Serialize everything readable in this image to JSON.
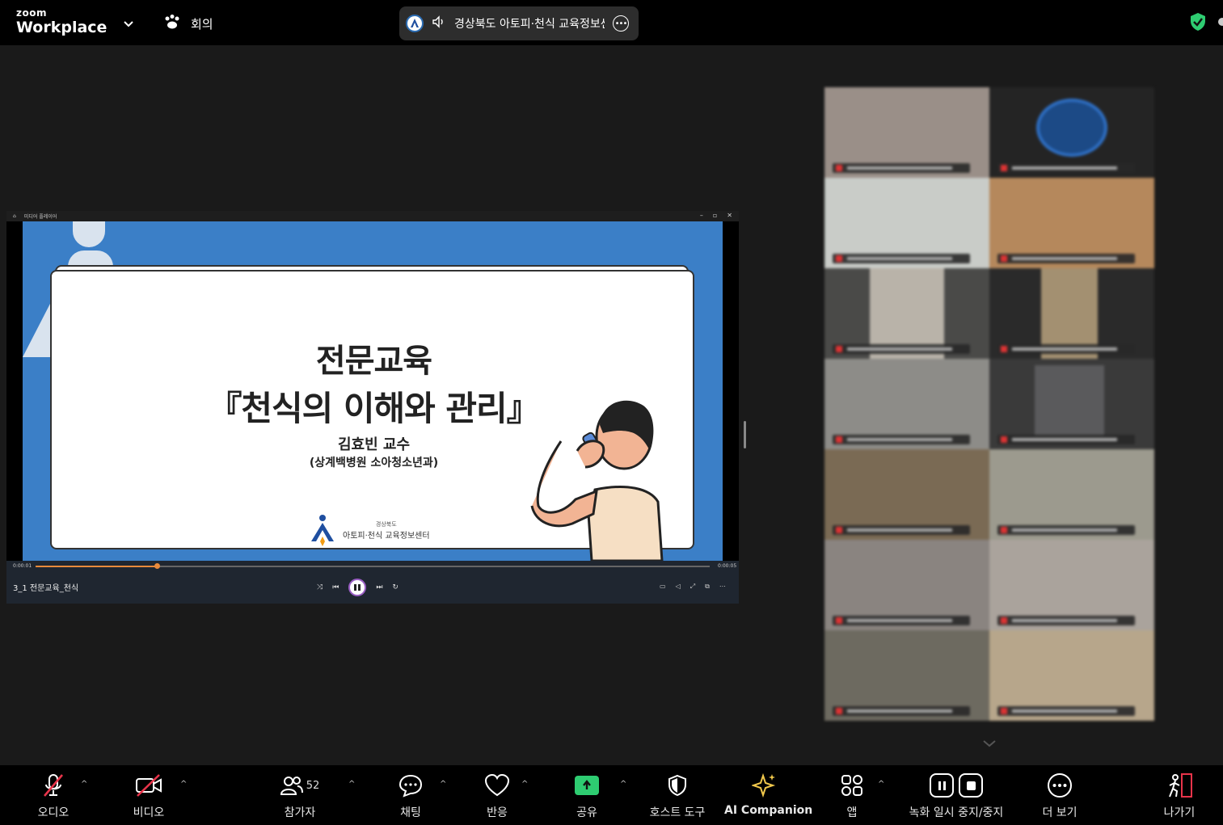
{
  "app": {
    "logo_top": "zoom",
    "logo_bottom": "Workplace"
  },
  "header": {
    "meeting_label": "회의",
    "share_pill_text": "경상북도 아토피·천식 교육정보센터"
  },
  "media_player": {
    "window_title": "미디어 플레이어",
    "time_current": "0:00:01",
    "time_total": "0:00:05",
    "progress_fraction": 0.18,
    "file_name": "3_1 전문교육_천식"
  },
  "slide": {
    "title_line1": "전문교육",
    "title_line2": "『천식의 이해와 관리』",
    "presenter": "김효빈 교수",
    "affiliation": "(상계백병원 소아청소년과)",
    "logo_small": "경상북도",
    "logo_big": "아토피·천식 교육정보센터"
  },
  "toolbar": {
    "audio": "오디오",
    "video": "비디오",
    "participants": "참가자",
    "participants_count": "52",
    "chat": "채팅",
    "reactions": "반응",
    "share": "공유",
    "host_tools": "호스트 도구",
    "ai_companion": "AI Companion",
    "apps": "앱",
    "record": "녹화 일시 중지/중지",
    "more": "더 보기",
    "leave": "나가기"
  },
  "colors": {
    "accent_green": "#2ecc71",
    "mute_red": "#e8344a",
    "slide_blue": "#3b7fc7",
    "progress_orange": "#e98a3b",
    "ai_gold": "#f2c94c"
  }
}
